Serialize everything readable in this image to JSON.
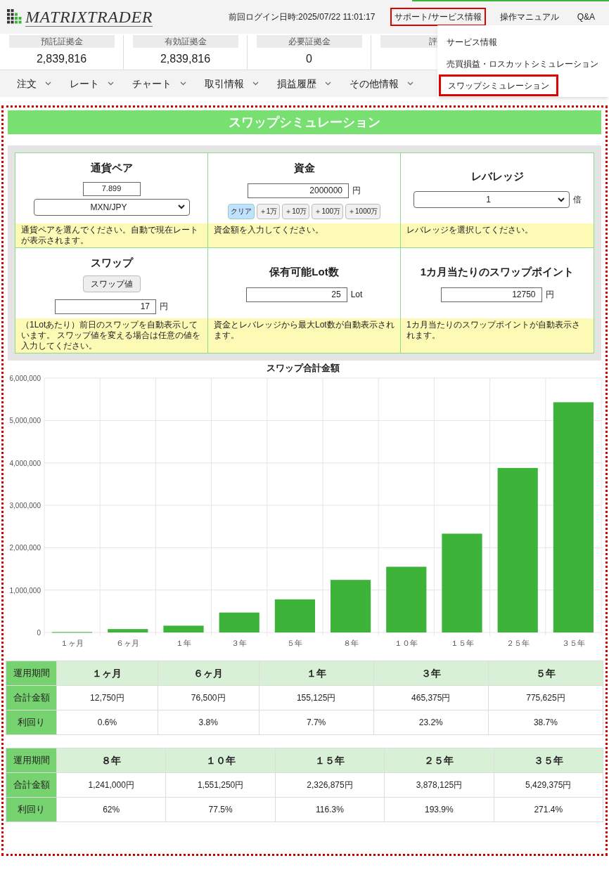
{
  "header": {
    "logo": "MATRIXTRADER",
    "last_login": "前回ログイン日時:2025/07/22 11:01:17",
    "links": [
      {
        "label": "サポート/サービス情報",
        "highlighted": true
      },
      {
        "label": "操作マニュアル",
        "highlighted": false
      },
      {
        "label": "Q&A",
        "highlighted": false
      }
    ]
  },
  "summary": [
    {
      "label": "預託証拠金",
      "value": "2,839,816"
    },
    {
      "label": "有効証拠金",
      "value": "2,839,816"
    },
    {
      "label": "必要証拠金",
      "value": "0"
    },
    {
      "label": "評"
    }
  ],
  "nav": [
    "注文",
    "レート",
    "チャート",
    "取引情報",
    "損益履歴",
    "その他情報"
  ],
  "dropdown": [
    {
      "label": "サービス情報",
      "highlighted": false
    },
    {
      "label": "売買損益・ロスカットシミュレーション",
      "highlighted": false
    },
    {
      "label": "スワップシミュレーション",
      "highlighted": true
    }
  ],
  "page_title": "スワップシミュレーション",
  "form_cells": [
    {
      "title": "通貨ペア",
      "rate": "7.899",
      "select": "MXN/JPY",
      "hint": "通貨ペアを選んでください。自動で現在レートが表示されます。"
    },
    {
      "title": "資金",
      "input": "2000000",
      "unit": "円",
      "buttons": [
        {
          "label": "クリア",
          "selected": true
        },
        {
          "label": "＋1万",
          "selected": false
        },
        {
          "label": "＋10万",
          "selected": false
        },
        {
          "label": "＋100万",
          "selected": false
        },
        {
          "label": "＋1000万",
          "selected": false
        }
      ],
      "hint": "資金額を入力してください。"
    },
    {
      "title": "レバレッジ",
      "select": "1",
      "unit": "倍",
      "hint": "レバレッジを選択してください。"
    },
    {
      "title": "スワップ",
      "action": "スワップ値",
      "input": "17",
      "unit": "円",
      "hint": "（1Lotあたり）前日のスワップを自動表示しています。 スワップ値を変える場合は任意の値を入力してください。"
    },
    {
      "title": "保有可能Lot数",
      "input": "25",
      "unit": "Lot",
      "hint": "資金とレバレッジから最大Lot数が自動表示されます。"
    },
    {
      "title": "1カ月当たりのスワップポイント",
      "input": "12750",
      "unit": "円",
      "hint": "1カ月当たりのスワップポイントが自動表示されます。"
    }
  ],
  "chart_data": {
    "type": "bar",
    "title": "スワップ合計金額",
    "categories": [
      "１ヶ月",
      "６ヶ月",
      "１年",
      "３年",
      "５年",
      "８年",
      "１０年",
      "１５年",
      "２５年",
      "３５年"
    ],
    "series": [
      {
        "color": "#3db33a",
        "values": [
          10000,
          80000,
          160000,
          470000,
          780000,
          1240000,
          1550000,
          2330000,
          3880000,
          5430000
        ]
      }
    ],
    "grid": true,
    "ylim": [
      0,
      6000000
    ],
    "yticks": [
      {
        "value": 0,
        "label": "0"
      },
      {
        "value": 1000000,
        "label": "1,000,000"
      },
      {
        "value": 2000000,
        "label": "2,000,000"
      },
      {
        "value": 3000000,
        "label": "3,000,000"
      },
      {
        "value": 4000000,
        "label": "4,000,000"
      },
      {
        "value": 5000000,
        "label": "5,000,000"
      },
      {
        "value": 6000000,
        "label": "6,000,000"
      }
    ]
  },
  "result_tables": [
    {
      "rows": [
        {
          "kind": "header",
          "label": "運用期間",
          "cells": [
            "１ヶ月",
            "６ヶ月",
            "１年",
            "３年",
            "５年"
          ]
        },
        {
          "kind": "data",
          "label": "合計金額",
          "cells": [
            "12,750円",
            "76,500円",
            "155,125円",
            "465,375円",
            "775,625円"
          ]
        },
        {
          "kind": "data",
          "label": "利回り",
          "cells": [
            "0.6%",
            "3.8%",
            "7.7%",
            "23.2%",
            "38.7%"
          ]
        }
      ]
    },
    {
      "rows": [
        {
          "kind": "header",
          "label": "運用期間",
          "cells": [
            "８年",
            "１０年",
            "１５年",
            "２５年",
            "３５年"
          ]
        },
        {
          "kind": "data",
          "label": "合計金額",
          "cells": [
            "1,241,000円",
            "1,551,250円",
            "2,326,875円",
            "3,878,125円",
            "5,429,375円"
          ]
        },
        {
          "kind": "data",
          "label": "利回り",
          "cells": [
            "62%",
            "77.5%",
            "116.3%",
            "193.9%",
            "271.4%"
          ]
        }
      ]
    }
  ]
}
